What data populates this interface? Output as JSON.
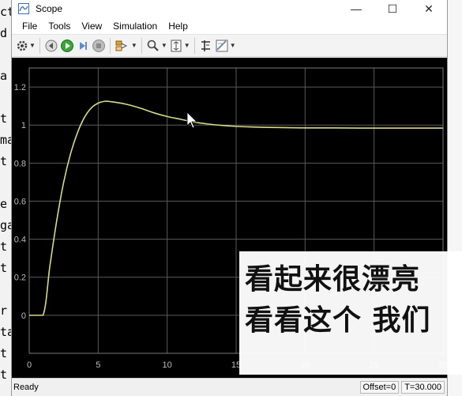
{
  "window": {
    "title": "Scope",
    "controls": {
      "minimize": "—",
      "maximize": "☐",
      "close": "✕"
    }
  },
  "menu": [
    "File",
    "Tools",
    "View",
    "Simulation",
    "Help"
  ],
  "toolbar": {
    "icons": [
      "settings-icon",
      "step-back-icon",
      "run-icon",
      "step-forward-icon",
      "stop-icon",
      "highlight-icon",
      "zoom-icon",
      "fit-axes-icon",
      "signal-cursors-icon",
      "measurements-icon"
    ]
  },
  "left_strip": [
    "ct",
    "d",
    "",
    "a",
    "",
    "t",
    "ma",
    "t",
    "",
    "e",
    "ga",
    "t",
    "t",
    "",
    "r",
    "ta",
    "t",
    "t"
  ],
  "chart_data": {
    "type": "line",
    "xlim": [
      0,
      30
    ],
    "ylim": [
      -0.2,
      1.3
    ],
    "xticks": [
      0,
      5,
      10,
      15,
      20,
      25,
      30
    ],
    "yticks": [
      0,
      0.2,
      0.4,
      0.6,
      0.8,
      1,
      1.2
    ],
    "xtick_labels": [
      "0",
      "5",
      "10",
      "15",
      "20",
      "25",
      "30"
    ],
    "ytick_labels": [
      "0",
      "0.2",
      "0.4",
      "0.6",
      "0.8",
      "1",
      "1.2"
    ],
    "grid": true,
    "background": "#000000",
    "line_color": "#d9d98a",
    "grid_color": "#5a5a5a",
    "series": [
      {
        "x": [
          0,
          1,
          1.5,
          2,
          2.5,
          3,
          3.5,
          4,
          4.5,
          5,
          5.5,
          6,
          7,
          8,
          9,
          10,
          11,
          12,
          13,
          14,
          15,
          16,
          17,
          18,
          20,
          22,
          24,
          26,
          28,
          30
        ],
        "y": [
          0,
          0,
          0.26,
          0.5,
          0.7,
          0.85,
          0.96,
          1.04,
          1.09,
          1.115,
          1.125,
          1.122,
          1.11,
          1.09,
          1.065,
          1.045,
          1.03,
          1.015,
          1.005,
          0.998,
          0.993,
          0.99,
          0.988,
          0.987,
          0.985,
          0.985,
          0.984,
          0.984,
          0.984,
          0.984
        ]
      }
    ]
  },
  "overlay_subtitle": [
    "看起来很漂亮",
    "看看这个 我们"
  ],
  "status": {
    "left": "Ready",
    "offset": "Offset=0",
    "time": "T=30.000"
  }
}
